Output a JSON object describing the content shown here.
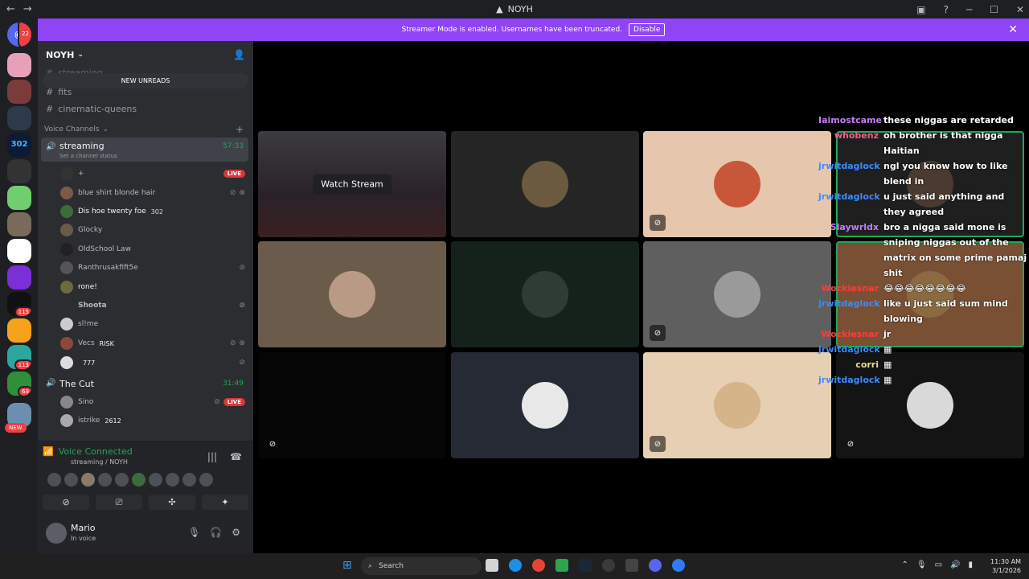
{
  "window": {
    "title": "NOYH",
    "back": "←",
    "forward": "→"
  },
  "banner": {
    "text": "Streamer Mode is enabled. Usernames have been truncated.",
    "button": "Disable",
    "close": "✕"
  },
  "rail": {
    "badges": [
      "22",
      "115",
      "113",
      "69"
    ],
    "new_label": "NEW"
  },
  "server": {
    "name": "NOYH",
    "new_unreads": "NEW UNREADS"
  },
  "channels": {
    "streaming_text": "streaming",
    "fits": "fits",
    "cinematic": "cinematic-queens",
    "voice_category": "Voice Channels"
  },
  "voice_channels": [
    {
      "name": "streaming",
      "sub": "Set a channel status",
      "time": "57:33"
    },
    {
      "name": "The Cut",
      "time": "31:49"
    }
  ],
  "members_streaming": [
    {
      "name": "+",
      "tag": "LIVE"
    },
    {
      "name": "blue shirt blonde hair"
    },
    {
      "name": "Dis hoe twenty foe",
      "tag": "302"
    },
    {
      "name": "Glocky"
    },
    {
      "name": "OldSchool Law"
    },
    {
      "name": "Ranthrusakfift5e"
    },
    {
      "name": "rone!"
    },
    {
      "name": "Shoota"
    },
    {
      "name": "sl!me"
    },
    {
      "name": "Vecs",
      "tag": "RISK"
    },
    {
      "name": "",
      "tag": "777"
    }
  ],
  "members_cut": [
    {
      "name": "Sino",
      "tag": "LIVE"
    },
    {
      "name": "istrike",
      "tag": "2612"
    }
  ],
  "voice_panel": {
    "status": "Voice Connected",
    "location": "streaming / NOYH"
  },
  "user": {
    "name": "Mario",
    "status": "In voice"
  },
  "stage": {
    "watch_stream": "Watch Stream"
  },
  "chat": [
    {
      "user": "Iaimostcame",
      "color": "#c37cf7",
      "msg": "these niggas are retarded"
    },
    {
      "user": "whobenz",
      "color": "#ff5c8a",
      "msg": "oh brother is that nigga Haitian"
    },
    {
      "user": "jrwitdaglock",
      "color": "#3a8bff",
      "msg": "ngl you know how to like blend in"
    },
    {
      "user": "jrwitdaglock",
      "color": "#3a8bff",
      "msg": "u just said anything and they agreed"
    },
    {
      "user": "Slaywrldx",
      "color": "#c37cf7",
      "msg": "bro a nigga said mone is sniping niggas out of the matrix on some prime pamaj shit"
    },
    {
      "user": "Wockiesnar",
      "color": "#ff3b3b",
      "msg": "😂😂😂😂😂😂😂😂"
    },
    {
      "user": "jrwitdaglock",
      "color": "#3a8bff",
      "msg": "like u just said sum mind blowing"
    },
    {
      "user": "Wockiesnar",
      "color": "#ff3b3b",
      "msg": "jr"
    },
    {
      "user": "jrwitdaglock",
      "color": "#3a8bff",
      "msg": ""
    },
    {
      "user": "corri",
      "color": "#f0d78c",
      "msg": ""
    },
    {
      "user": "jrwitdaglock",
      "color": "#3a8bff",
      "msg": ""
    }
  ],
  "taskbar": {
    "search": "Search",
    "time": "11:30 AM",
    "date": "3/1/2026"
  }
}
